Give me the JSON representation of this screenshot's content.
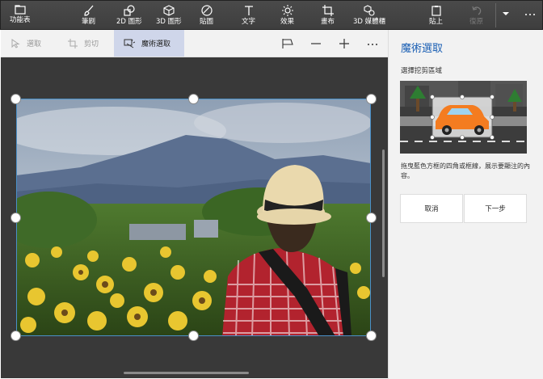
{
  "toolbar": {
    "menu_label": "功能表",
    "brushes_label": "筆刷",
    "shapes2d_label": "2D 圖形",
    "shapes3d_label": "3D 圖形",
    "stickers_label": "貼圖",
    "text_label": "文字",
    "effects_label": "效果",
    "canvas_label": "畫布",
    "library3d_label": "3D 媒體櫃",
    "paste_label": "貼上",
    "undo_label": "復原"
  },
  "subbar": {
    "select_label": "選取",
    "crop_label": "剪切",
    "magic_select_label": "魔術選取"
  },
  "panel": {
    "title": "魔術選取",
    "subtitle": "選擇挖剪區域",
    "description": "拖曳藍色方框的四角或框線，展示要顯注的內容。",
    "cancel_label": "取消",
    "next_label": "下一步"
  },
  "colors": {
    "toolbar_bg": "#444444",
    "canvas_bg": "#393939",
    "accent": "#1a5fb4",
    "active_tab": "#cfd6ea"
  }
}
